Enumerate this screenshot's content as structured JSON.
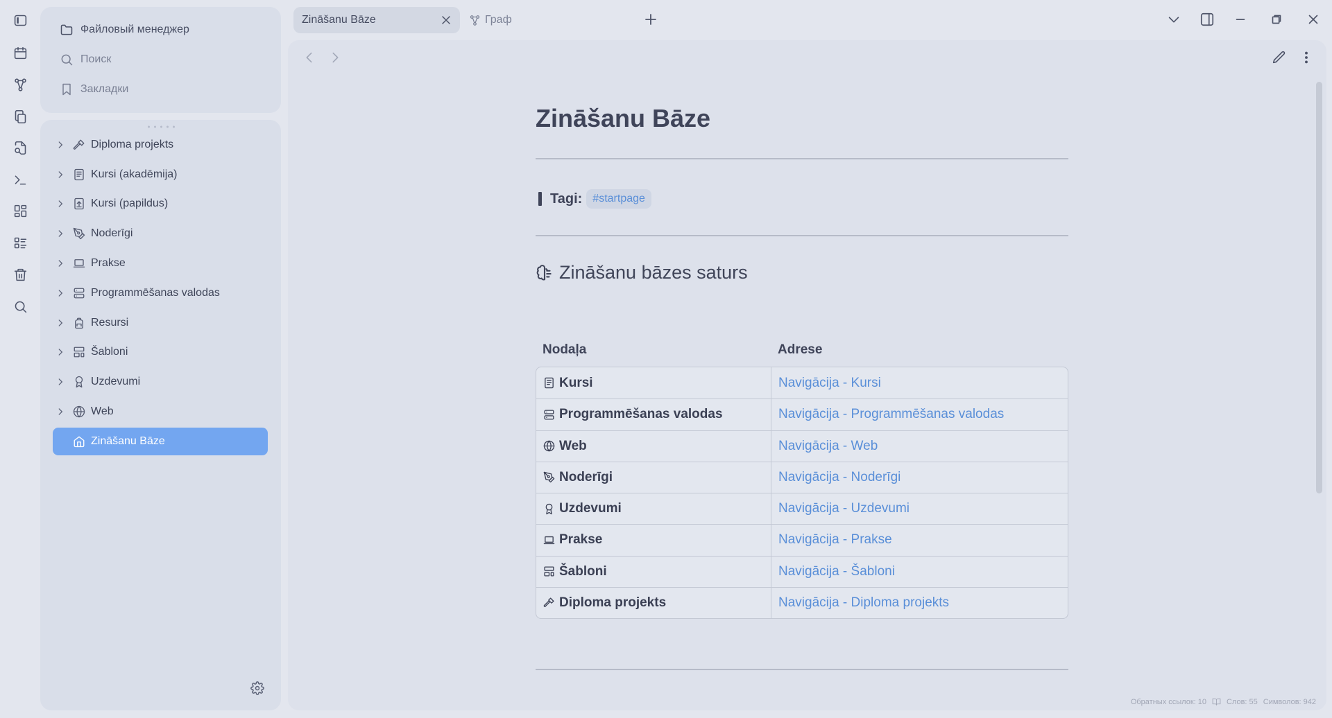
{
  "ribbon": {
    "icons": [
      "sidebar-toggle-icon",
      "calendar-icon",
      "graph-icon",
      "copy-icon",
      "file-search-icon",
      "terminal-icon",
      "grid-icon",
      "list-checks-icon",
      "trash-icon",
      "search-icon"
    ]
  },
  "sidebar": {
    "top_items": [
      {
        "label": "Файловый менеджер",
        "icon": "folder-icon"
      },
      {
        "label": "Поиск",
        "icon": "search-icon"
      },
      {
        "label": "Закладки",
        "icon": "bookmark-icon"
      }
    ],
    "tree": [
      {
        "label": "Diploma projekts",
        "icon": "hammer-icon"
      },
      {
        "label": "Kursi (akadēmija)",
        "icon": "notebook-icon"
      },
      {
        "label": "Kursi (papildus)",
        "icon": "file-up-icon"
      },
      {
        "label": "Noderīgi",
        "icon": "pen-tool-icon"
      },
      {
        "label": "Prakse",
        "icon": "laptop-icon"
      },
      {
        "label": "Programmēšanas valodas",
        "icon": "server-icon"
      },
      {
        "label": "Resursi",
        "icon": "backpack-icon"
      },
      {
        "label": "Šabloni",
        "icon": "layout-template-icon"
      },
      {
        "label": "Uzdevumi",
        "icon": "award-icon"
      },
      {
        "label": "Web",
        "icon": "globe-icon"
      }
    ],
    "active_item": {
      "label": "Zināšanu Bāze",
      "icon": "home-icon"
    }
  },
  "tabs": {
    "active": "Zināšanu Bāze",
    "graph": "Граф"
  },
  "document": {
    "title": "Zināšanu Bāze",
    "tags_label": "Tagi:",
    "tag": "#startpage",
    "section_heading": "Zināšanu bāzes saturs",
    "table": {
      "headers": [
        "Nodaļa",
        "Adrese"
      ],
      "rows": [
        {
          "name": "Kursi",
          "link": "Navigācija - Kursi",
          "icon": "notebook-icon"
        },
        {
          "name": "Programmēšanas valodas",
          "link": "Navigācija - Programmēšanas valodas",
          "icon": "server-icon"
        },
        {
          "name": "Web",
          "link": "Navigācija - Web",
          "icon": "globe-icon"
        },
        {
          "name": "Noderīgi",
          "link": "Navigācija - Noderīgi",
          "icon": "pen-tool-icon"
        },
        {
          "name": "Uzdevumi",
          "link": "Navigācija - Uzdevumi",
          "icon": "award-icon"
        },
        {
          "name": "Prakse",
          "link": "Navigācija - Prakse",
          "icon": "laptop-icon"
        },
        {
          "name": "Šabloni",
          "link": "Navigācija - Šabloni",
          "icon": "layout-template-icon"
        },
        {
          "name": "Diploma projekts",
          "link": "Navigācija - Diploma projekts",
          "icon": "hammer-icon"
        }
      ]
    }
  },
  "status": {
    "backlinks": "Обратных ссылок: 10",
    "words": "Слов: 55",
    "chars": "Символов: 942"
  },
  "colors": {
    "accent": "#73a6f0",
    "link": "#5a8fd8",
    "background": "#e3e6ee",
    "panel": "#d9dee9"
  }
}
